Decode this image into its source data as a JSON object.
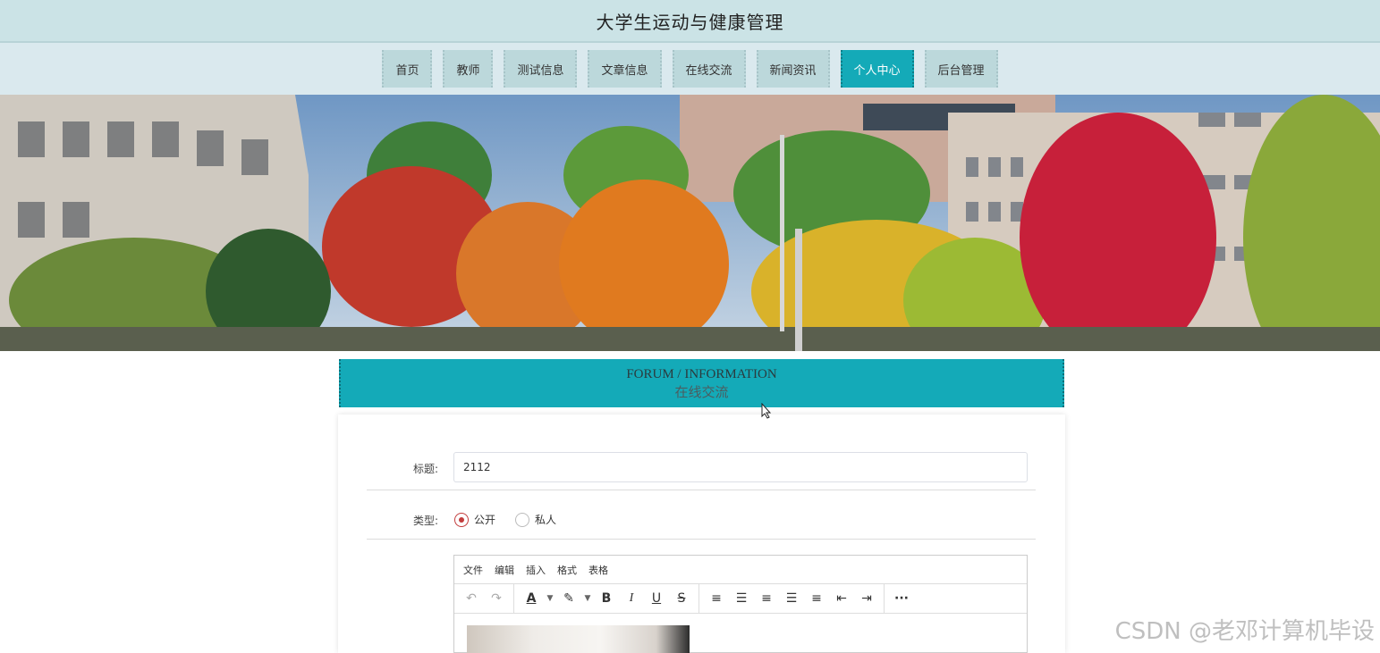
{
  "site": {
    "title": "大学生运动与健康管理"
  },
  "nav": {
    "items": [
      {
        "label": "首页"
      },
      {
        "label": "教师"
      },
      {
        "label": "测试信息"
      },
      {
        "label": "文章信息"
      },
      {
        "label": "在线交流"
      },
      {
        "label": "新闻资讯"
      },
      {
        "label": "个人中心"
      },
      {
        "label": "后台管理"
      }
    ],
    "active_index": 6
  },
  "section": {
    "title_en": "FORUM / INFORMATION",
    "title_cn": "在线交流"
  },
  "form": {
    "title_label": "标题:",
    "title_value": "2112",
    "type_label": "类型:",
    "type_options": [
      {
        "label": "公开",
        "checked": true
      },
      {
        "label": "私人",
        "checked": false
      }
    ]
  },
  "editor": {
    "menu": [
      "文件",
      "编辑",
      "插入",
      "格式",
      "表格"
    ],
    "toolbar_icons": [
      "undo-icon",
      "redo-icon",
      "font-color-icon",
      "highlight-color-icon",
      "bold-icon",
      "italic-icon",
      "underline-icon",
      "strikethrough-icon",
      "line-height-icon",
      "align-left-icon",
      "align-center-icon",
      "align-right-icon",
      "align-justify-icon",
      "outdent-icon",
      "indent-icon",
      "more-icon"
    ]
  },
  "watermark": {
    "text": "CSDN @老邓计算机毕设"
  },
  "colors": {
    "accent": "#14aab8",
    "title_bar": "#cbe3e6",
    "nav_bar": "#dae9ee",
    "nav_item": "#bcd8db",
    "radio_checked": "#c23b3b"
  }
}
